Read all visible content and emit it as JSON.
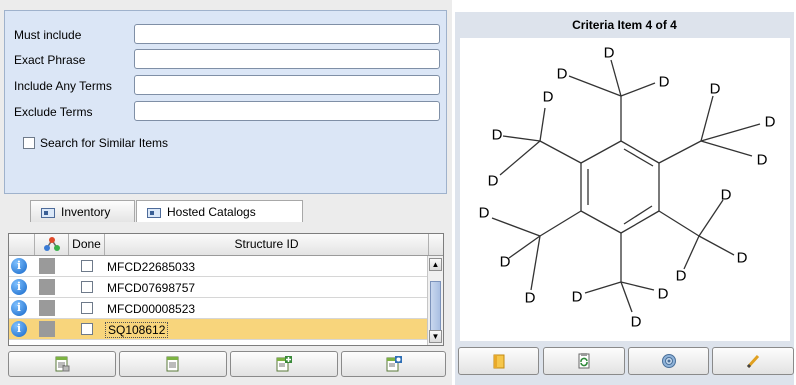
{
  "search": {
    "must_include_label": "Must include",
    "must_include_value": "",
    "exact_phrase_label": "Exact Phrase",
    "exact_phrase_value": "",
    "include_any_label": "Include Any Terms",
    "include_any_value": "",
    "exclude_label": "Exclude Terms",
    "exclude_value": "",
    "similar_label": "Search for Similar Items",
    "similar_checked": false
  },
  "tabs": [
    {
      "label": "Inventory",
      "active": false
    },
    {
      "label": "Hosted Catalogs",
      "active": true
    }
  ],
  "table": {
    "headers": {
      "done": "Done",
      "structure_id": "Structure ID"
    },
    "rows": [
      {
        "structure_id": "MFCD22685033",
        "done": false,
        "selected": false
      },
      {
        "structure_id": "MFCD07698757",
        "done": false,
        "selected": false
      },
      {
        "structure_id": "MFCD00008523",
        "done": false,
        "selected": false
      },
      {
        "structure_id": "SQ108612",
        "done": false,
        "selected": true
      }
    ]
  },
  "bottom_buttons": [
    {
      "icon": "document-list-icon"
    },
    {
      "icon": "list-icon"
    },
    {
      "icon": "add-list-icon"
    },
    {
      "icon": "settings-list-icon"
    }
  ],
  "criteria": {
    "title": "Criteria Item 4 of 4",
    "atom_label": "D"
  },
  "right_buttons": [
    {
      "icon": "folder-icon"
    },
    {
      "icon": "refresh-document-icon"
    },
    {
      "icon": "gear-icon"
    },
    {
      "icon": "pencil-icon"
    }
  ],
  "colors": {
    "search_panel_bg": "#dbe6f6",
    "selected_row": "#f8d57c",
    "info_icon": "#1466c8"
  }
}
